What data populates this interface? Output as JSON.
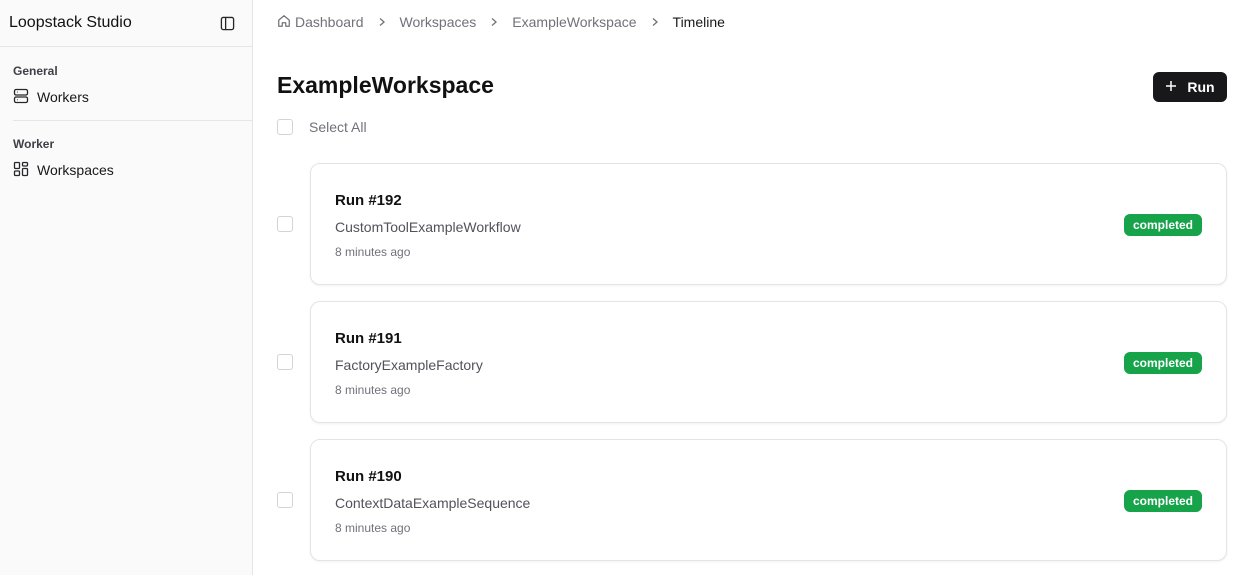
{
  "sidebar": {
    "app_title": "Loopstack Studio",
    "toggle_icon": "sidebar-toggle-icon",
    "groups": [
      {
        "label": "General",
        "items": [
          {
            "label": "Workers",
            "icon": "server-icon"
          }
        ]
      },
      {
        "label": "Worker",
        "items": [
          {
            "label": "Workspaces",
            "icon": "dashboard-grid-icon"
          }
        ]
      }
    ]
  },
  "breadcrumb": {
    "items": [
      {
        "label": "Dashboard",
        "icon": "home-icon"
      },
      {
        "label": "Workspaces"
      },
      {
        "label": "ExampleWorkspace"
      },
      {
        "label": "Timeline"
      }
    ]
  },
  "header": {
    "title": "ExampleWorkspace",
    "run_button_label": "Run",
    "run_button_icon": "plus-icon"
  },
  "select_all_label": "Select All",
  "runs": [
    {
      "title": "Run #192",
      "workflow": "CustomToolExampleWorkflow",
      "time": "8 minutes ago",
      "status": "completed"
    },
    {
      "title": "Run #191",
      "workflow": "FactoryExampleFactory",
      "time": "8 minutes ago",
      "status": "completed"
    },
    {
      "title": "Run #190",
      "workflow": "ContextDataExampleSequence",
      "time": "8 minutes ago",
      "status": "completed"
    }
  ],
  "colors": {
    "status_completed": "#16a34a",
    "primary_button": "#18181b"
  }
}
